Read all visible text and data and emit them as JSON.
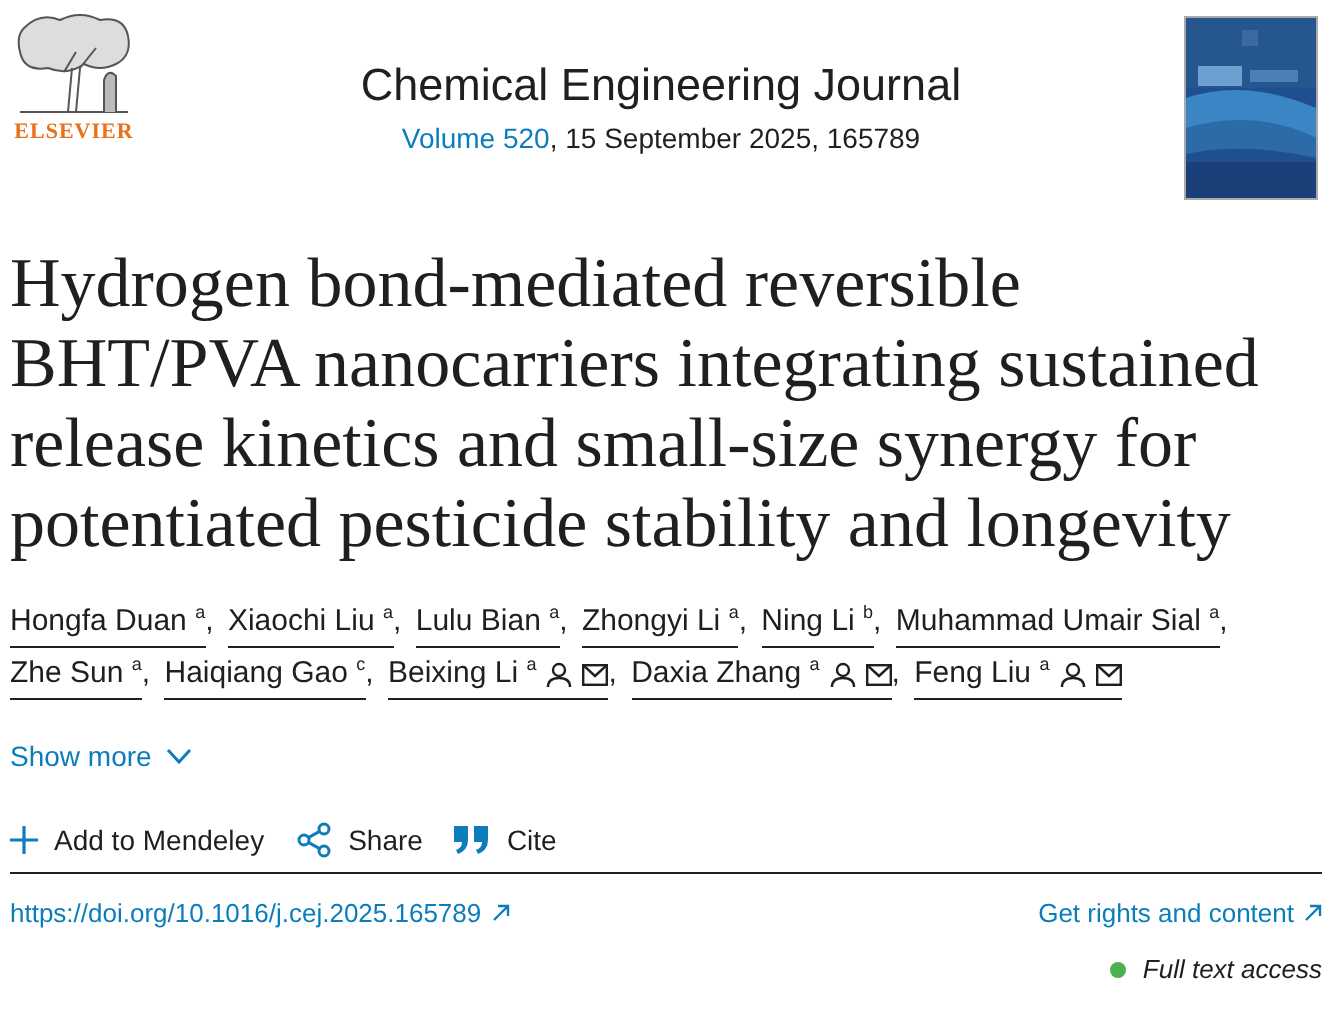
{
  "header": {
    "publisher": "ELSEVIER",
    "journal": "Chemical Engineering Journal",
    "volume_link": "Volume 520",
    "issue_info": ", 15 September 2025, 165789"
  },
  "title": "Hydrogen bond-mediated reversible BHT/PVA nanocarriers integrating sustained release kinetics and small-size synergy for potentiated pesticide stability and longevity",
  "authors": [
    {
      "name": "Hongfa Duan",
      "affiliation": "a",
      "profile": false,
      "email": false,
      "separator": ","
    },
    {
      "name": "Xiaochi Liu",
      "affiliation": "a",
      "profile": false,
      "email": false,
      "separator": ","
    },
    {
      "name": "Lulu Bian",
      "affiliation": "a",
      "profile": false,
      "email": false,
      "separator": ","
    },
    {
      "name": "Zhongyi Li",
      "affiliation": "a",
      "profile": false,
      "email": false,
      "separator": ","
    },
    {
      "name": "Ning Li",
      "affiliation": "b",
      "profile": false,
      "email": false,
      "separator": ","
    },
    {
      "name": "Muhammad Umair Sial",
      "affiliation": "a",
      "profile": false,
      "email": false,
      "separator": ","
    },
    {
      "name": "Zhe Sun",
      "affiliation": "a",
      "profile": false,
      "email": false,
      "separator": ","
    },
    {
      "name": "Haiqiang Gao",
      "affiliation": "c",
      "profile": false,
      "email": false,
      "separator": ","
    },
    {
      "name": "Beixing Li",
      "affiliation": "a",
      "profile": true,
      "email": true,
      "separator": ","
    },
    {
      "name": "Daxia Zhang",
      "affiliation": "a",
      "profile": true,
      "email": true,
      "separator": ","
    },
    {
      "name": "Feng Liu",
      "affiliation": "a",
      "profile": true,
      "email": true
    }
  ],
  "show_more": {
    "label": "Show more",
    "expanded": false
  },
  "actions": [
    {
      "kind": "add",
      "label": "Add to Mendeley"
    },
    {
      "kind": "share",
      "label": "Share"
    },
    {
      "kind": "cite",
      "label": "Cite"
    }
  ],
  "doi": "https://doi.org/10.1016/j.cej.2025.165789",
  "rights": "Get rights and content",
  "access": {
    "label": "Full text access",
    "color": "#4caf50"
  }
}
